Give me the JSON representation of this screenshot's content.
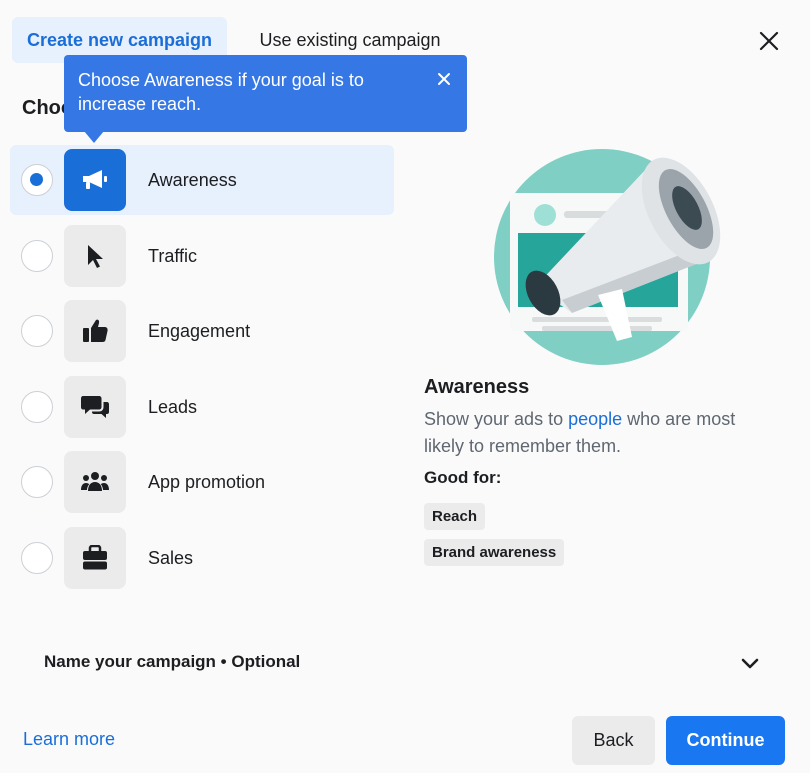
{
  "tabs": {
    "create_label": "Create new campaign",
    "existing_label": "Use existing campaign"
  },
  "section": {
    "heading_visible": "Choo"
  },
  "tooltip": {
    "text": "Choose Awareness if your goal is to increase reach."
  },
  "objectives": [
    {
      "label": "Awareness",
      "icon": "megaphone-icon",
      "selected": true
    },
    {
      "label": "Traffic",
      "icon": "cursor-icon",
      "selected": false
    },
    {
      "label": "Engagement",
      "icon": "thumbs-up-icon",
      "selected": false
    },
    {
      "label": "Leads",
      "icon": "chat-bubbles-icon",
      "selected": false
    },
    {
      "label": "App promotion",
      "icon": "people-icon",
      "selected": false
    },
    {
      "label": "Sales",
      "icon": "briefcase-icon",
      "selected": false
    }
  ],
  "detail": {
    "title": "Awareness",
    "desc_before": "Show your ads to ",
    "desc_link": "people",
    "desc_after": " who are most likely to remember them.",
    "good_for_label": "Good for:",
    "tags": [
      "Reach",
      "Brand awareness"
    ]
  },
  "name_campaign": {
    "label": "Name your campaign • Optional"
  },
  "footer": {
    "learn_more": "Learn more",
    "back": "Back",
    "continue": "Continue"
  },
  "colors": {
    "accent": "#1a77f2",
    "tooltip_bg": "#3578e5",
    "selected_bg": "#e7f0fd",
    "illustration_teal": "#26a69a"
  }
}
